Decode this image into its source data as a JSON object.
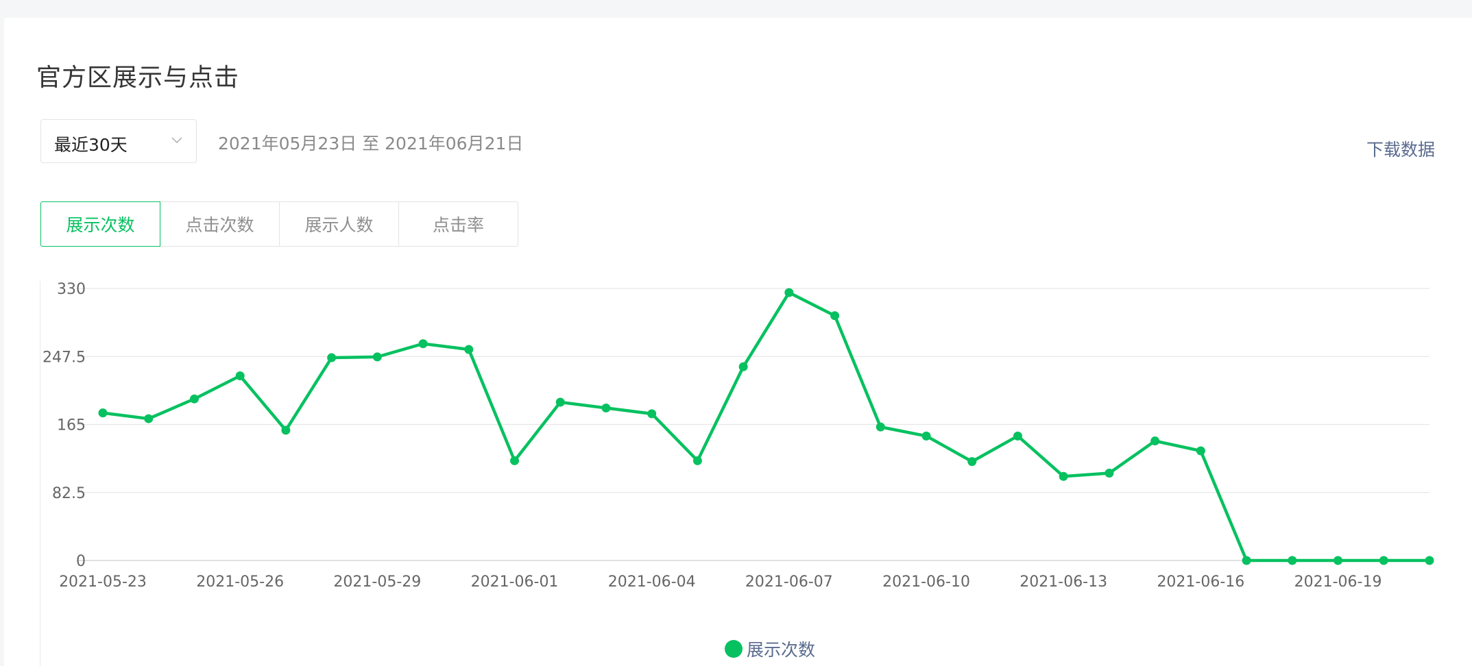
{
  "page": {
    "title": "官方区展示与点击",
    "range_select": {
      "value": "最近30天",
      "icon": "chevron-down-icon"
    },
    "date_range": "2021年05月23日 至 2021年06月21日",
    "download_label": "下载数据",
    "tabs": [
      {
        "label": "展示次数",
        "active": true
      },
      {
        "label": "点击次数",
        "active": false
      },
      {
        "label": "展示人数",
        "active": false
      },
      {
        "label": "点击率",
        "active": false
      }
    ],
    "accent_color": "#07c160"
  },
  "chart_data": {
    "type": "line",
    "title": "",
    "xlabel": "",
    "ylabel": "",
    "ylim": [
      0,
      330
    ],
    "y_ticks": [
      "0",
      "82.5",
      "165",
      "247.5",
      "330"
    ],
    "x_tick_labels": [
      "2021-05-23",
      "2021-05-26",
      "2021-05-29",
      "2021-06-01",
      "2021-06-04",
      "2021-06-07",
      "2021-06-10",
      "2021-06-13",
      "2021-06-16",
      "2021-06-19"
    ],
    "x": [
      "2021-05-23",
      "2021-05-24",
      "2021-05-25",
      "2021-05-26",
      "2021-05-27",
      "2021-05-28",
      "2021-05-29",
      "2021-05-30",
      "2021-05-31",
      "2021-06-01",
      "2021-06-02",
      "2021-06-03",
      "2021-06-04",
      "2021-06-05",
      "2021-06-06",
      "2021-06-07",
      "2021-06-08",
      "2021-06-09",
      "2021-06-10",
      "2021-06-11",
      "2021-06-12",
      "2021-06-13",
      "2021-06-14",
      "2021-06-15",
      "2021-06-16",
      "2021-06-17",
      "2021-06-18",
      "2021-06-19",
      "2021-06-20",
      "2021-06-21"
    ],
    "series": [
      {
        "name": "展示次数",
        "color": "#07c160",
        "values": [
          179,
          172,
          196,
          224,
          158,
          246,
          247,
          263,
          256,
          121,
          192,
          185,
          178,
          121,
          235,
          325,
          297,
          162,
          151,
          120,
          151,
          102,
          106,
          145,
          133,
          0,
          0,
          0,
          0,
          0
        ]
      }
    ],
    "grid": true,
    "legend_position": "bottom-center"
  }
}
